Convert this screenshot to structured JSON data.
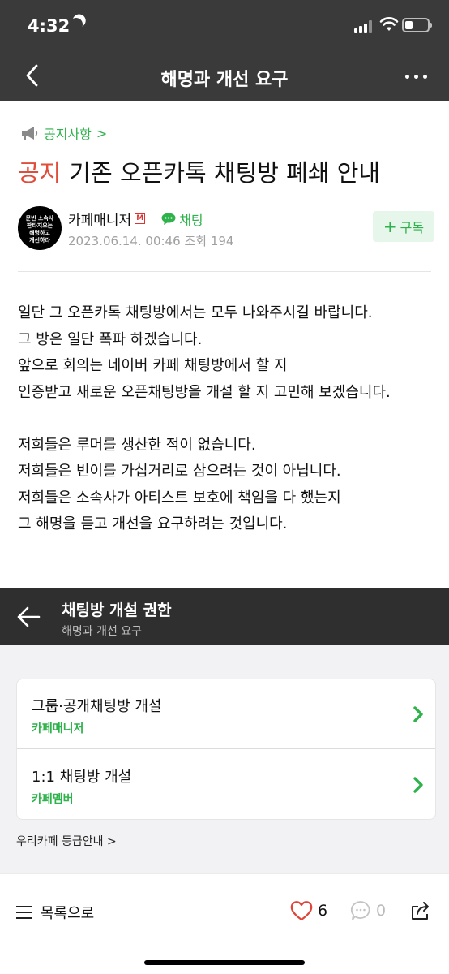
{
  "status": {
    "time": "4:32"
  },
  "header": {
    "title": "해명과 개선 요구"
  },
  "post": {
    "board": "공지사항",
    "board_chevron": ">",
    "tag": "공지",
    "title": "기존 오픈카톡 채팅방 폐쇄 안내",
    "author": {
      "avatar_lines": [
        "문빈 소속사",
        "판타지오는",
        "해명하고",
        "개선하라"
      ],
      "nickname": "카페매니저",
      "manager_badge": "M",
      "chat_label": "채팅",
      "date": "2023.06.14. 00:46",
      "views_label": "조회",
      "views": "194"
    },
    "subscribe": {
      "plus": "+",
      "label": "구독"
    },
    "body": [
      "일단 그 오픈카톡 채팅방에서는 모두 나와주시길 바랍니다.",
      "그 방은 일단 폭파 하겠습니다.",
      "앞으로 회의는 네이버 카페 채팅방에서 할 지",
      "인증받고 새로운 오픈채팅방을 개설 할 지 고민해 보겠습니다.",
      "",
      "저희들은 루머를 생산한 적이 없습니다.",
      "저희들은 빈이를 가십거리로 삼으려는 것이 아닙니다.",
      "저희들은 소속사가 아티스트 보호에 책임을 다 했는지",
      "그 해명을 듣고 개선을 요구하려는 것입니다."
    ]
  },
  "embed": {
    "title": "채팅방 개설 권한",
    "subtitle": "해명과 개선 요구",
    "items": [
      {
        "label": "그룹·공개채팅방 개설",
        "role": "카페매니저"
      },
      {
        "label": "1:1 채팅방 개설",
        "role": "카페멤버"
      }
    ],
    "grade_link": "우리카페 등급안내",
    "grade_chevron": ">"
  },
  "bottom": {
    "list_label": "목록으로",
    "likes": "6",
    "comments": "0"
  },
  "colors": {
    "header_bg": "#3a3a3a",
    "accent_green": "#2eb24b",
    "notice_red": "#e04d3b",
    "like_red": "#e0453a"
  },
  "icons": [
    "moon-icon",
    "signal-icon",
    "wifi-icon",
    "battery-icon",
    "back-icon",
    "more-icon",
    "megaphone-icon",
    "chat-bubble-icon",
    "chevron-right-icon",
    "menu-icon",
    "heart-icon",
    "comment-icon",
    "share-icon"
  ]
}
